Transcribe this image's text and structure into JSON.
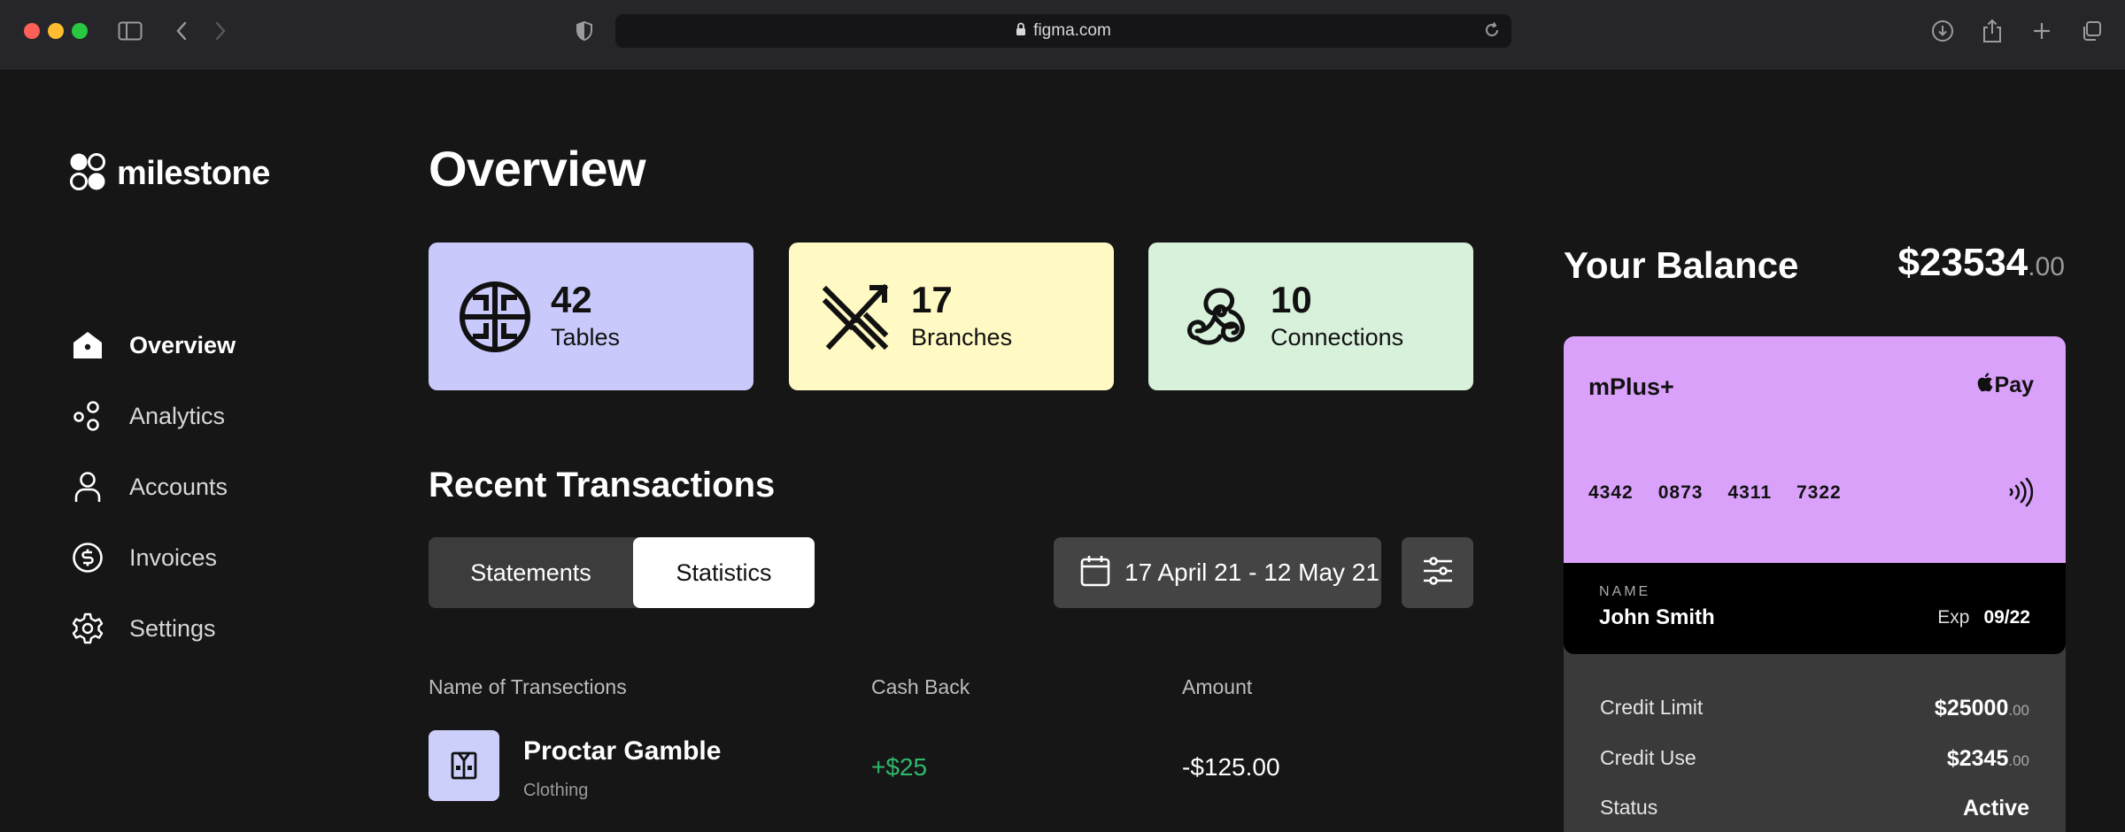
{
  "browser": {
    "url": "figma.com"
  },
  "brand": {
    "name": "milestone"
  },
  "sidebar": {
    "items": [
      {
        "label": "Overview",
        "icon": "home-icon",
        "active": true
      },
      {
        "label": "Analytics",
        "icon": "analytics-icon",
        "active": false
      },
      {
        "label": "Accounts",
        "icon": "user-icon",
        "active": false
      },
      {
        "label": "Invoices",
        "icon": "dollar-circle-icon",
        "active": false
      },
      {
        "label": "Settings",
        "icon": "gear-icon",
        "active": false
      }
    ]
  },
  "main": {
    "title": "Overview",
    "stats": [
      {
        "value": "42",
        "label": "Tables",
        "color": "#c9cafb",
        "icon": "tables-icon"
      },
      {
        "value": "17",
        "label": "Branches",
        "color": "#fff9c3",
        "icon": "branches-icon"
      },
      {
        "value": "10",
        "label": "Connections",
        "color": "#d7f1db",
        "icon": "connections-icon"
      }
    ],
    "transactions": {
      "title": "Recent Transactions",
      "tabs": [
        "Statements",
        "Statistics"
      ],
      "active_tab": "Statistics",
      "date_range": "17 April 21 - 12 May 21",
      "columns": [
        "Name of Transections",
        "Cash Back",
        "Amount"
      ],
      "rows": [
        {
          "name": "Proctar Gamble",
          "category": "Clothing",
          "cash_back": "+$25",
          "amount": "-$125.00"
        }
      ]
    }
  },
  "balance": {
    "title": "Your Balance",
    "amount": "$23534",
    "cents": ".00",
    "card": {
      "brand": "mPlus+",
      "pay_label": "Pay",
      "number_groups": [
        "4342",
        "0873",
        "4311",
        "7322"
      ],
      "name_label": "NAME",
      "name": "John Smith",
      "exp_label": "Exp",
      "exp": "09/22",
      "color": "#d9a1fa"
    },
    "details": [
      {
        "label": "Credit Limit",
        "value": "$25000",
        "cents": ".00"
      },
      {
        "label": "Credit Use",
        "value": "$2345",
        "cents": ".00"
      },
      {
        "label": "Status",
        "value": "Active",
        "cents": ""
      }
    ]
  },
  "colors": {
    "background": "#161616",
    "cashback": "#2fb86b"
  }
}
